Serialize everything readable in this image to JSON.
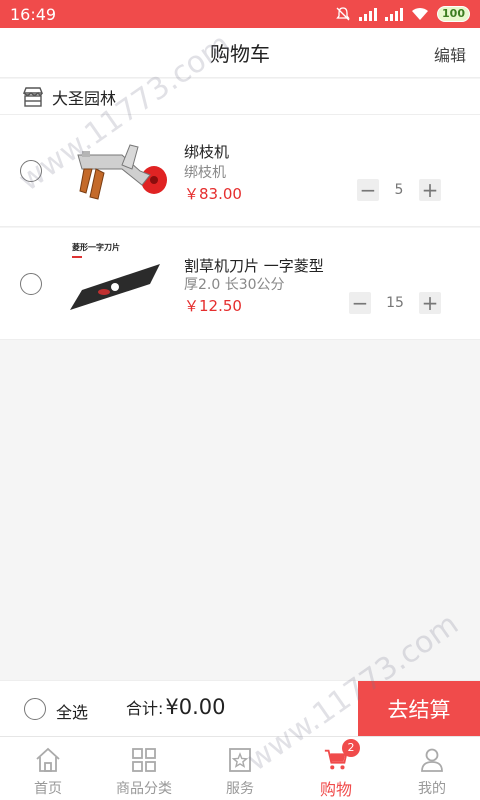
{
  "status_bar": {
    "time": "16:49",
    "battery": "100"
  },
  "nav": {
    "title": "购物车",
    "edit_label": "编辑"
  },
  "shop": {
    "name": "大圣园林"
  },
  "cart_items": [
    {
      "name": "绑枝机",
      "spec": "绑枝机",
      "price": "￥83.00",
      "quantity": "5",
      "selected": false
    },
    {
      "name": "割草机刀片 一字菱型",
      "spec": "厚2.0 长30公分",
      "price": "￥12.50",
      "quantity": "15",
      "selected": false
    }
  ],
  "product_image_text": {
    "blade_title": "菱形一字刀片"
  },
  "bottom_bar": {
    "select_all_label": "全选",
    "total_label": "合计:",
    "total_value": "¥0.00",
    "checkout_label": "去结算"
  },
  "tabbar": {
    "tabs": [
      {
        "label": "首页",
        "icon": "home-icon"
      },
      {
        "label": "商品分类",
        "icon": "grid-icon"
      },
      {
        "label": "服务",
        "icon": "star-badge-icon"
      },
      {
        "label": "购物",
        "icon": "cart-icon",
        "active": true,
        "badge": "2"
      },
      {
        "label": "我的",
        "icon": "user-icon"
      }
    ]
  },
  "watermark": {
    "text": "www.11773.com"
  },
  "colors": {
    "accent": "#f04b4b",
    "price": "#e52e2e",
    "background": "#f5f5f5"
  }
}
